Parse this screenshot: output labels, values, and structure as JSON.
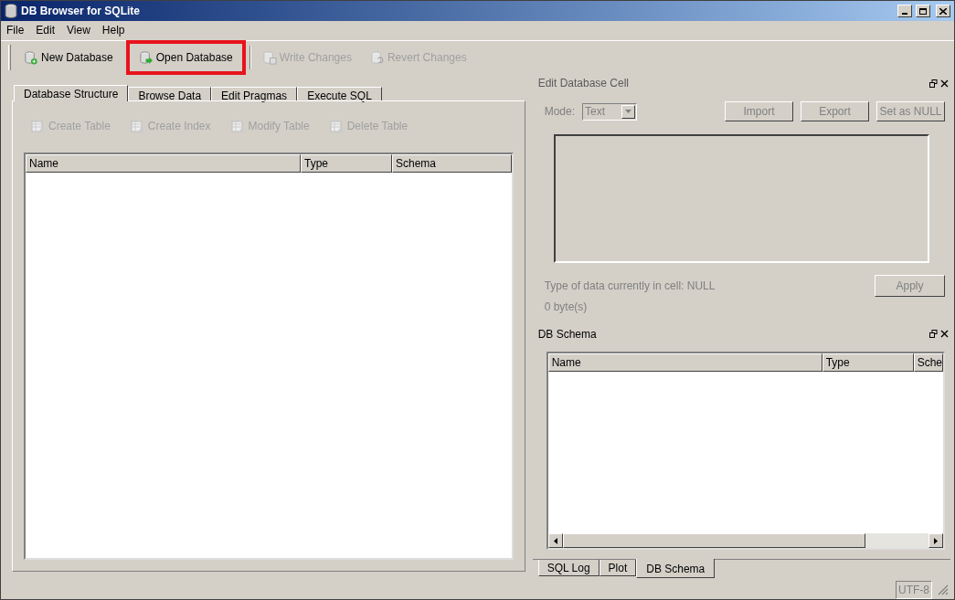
{
  "window": {
    "title": "DB Browser for SQLite"
  },
  "menu": [
    "File",
    "Edit",
    "View",
    "Help"
  ],
  "toolbar": [
    {
      "label": "New Database",
      "kind": "new",
      "disabled": false,
      "highlighted": false
    },
    {
      "label": "Open Database",
      "kind": "open",
      "disabled": false,
      "highlighted": true
    },
    {
      "label": "Write Changes",
      "kind": "write",
      "disabled": true,
      "highlighted": false
    },
    {
      "label": "Revert Changes",
      "kind": "revert",
      "disabled": true,
      "highlighted": false
    }
  ],
  "tabs": [
    {
      "label": "Database Structure",
      "selected": true
    },
    {
      "label": "Browse Data",
      "selected": false
    },
    {
      "label": "Edit Pragmas",
      "selected": false
    },
    {
      "label": "Execute SQL",
      "selected": false
    }
  ],
  "structure_toolbar": [
    {
      "label": "Create Table",
      "disabled": true
    },
    {
      "label": "Create Index",
      "disabled": true
    },
    {
      "label": "Modify Table",
      "disabled": true
    },
    {
      "label": "Delete Table",
      "disabled": true
    }
  ],
  "structure_table": {
    "columns": [
      "Name",
      "Type",
      "Schema"
    ]
  },
  "edit_cell": {
    "title": "Edit Database Cell",
    "mode_label": "Mode:",
    "mode_value": "Text",
    "buttons": [
      {
        "label": "Import",
        "disabled": true
      },
      {
        "label": "Export",
        "disabled": true
      },
      {
        "label": "Set as NULL",
        "disabled": true
      }
    ],
    "type_info": "Type of data currently in cell: NULL",
    "size_info": "0 byte(s)",
    "apply": {
      "label": "Apply",
      "disabled": true
    }
  },
  "schema": {
    "title": "DB Schema",
    "columns": [
      "Name",
      "Type",
      "Sche"
    ]
  },
  "bottom_tabs": [
    {
      "label": "SQL Log",
      "selected": false
    },
    {
      "label": "Plot",
      "selected": false
    },
    {
      "label": "DB Schema",
      "selected": true
    }
  ],
  "status_bar": {
    "encoding": "UTF-8"
  }
}
